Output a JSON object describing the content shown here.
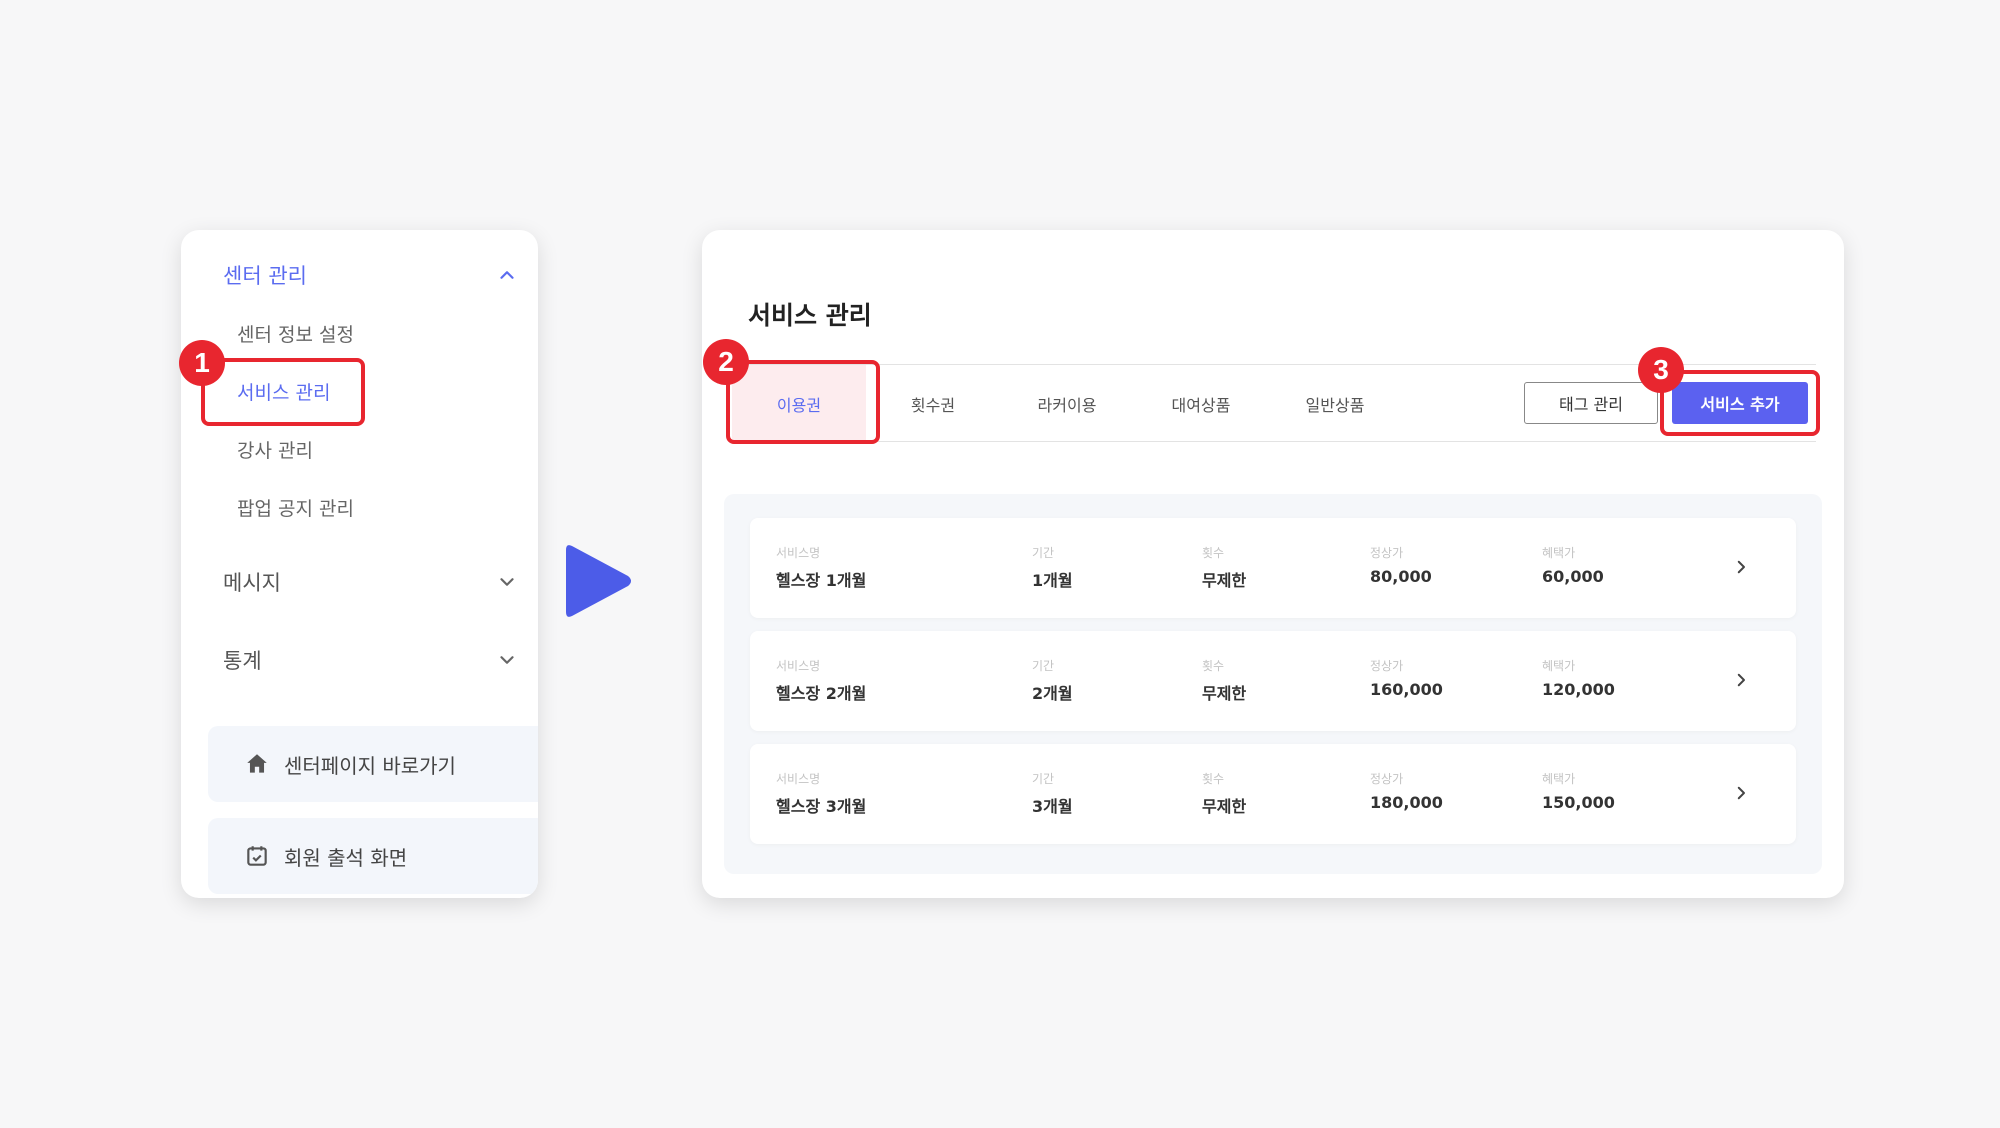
{
  "sidebar": {
    "groups": [
      {
        "label": "센터 관리",
        "expanded": true,
        "items": [
          "센터 정보 설정",
          "서비스 관리",
          "강사 관리",
          "팝업 공지 관리"
        ],
        "active_item": "서비스 관리"
      },
      {
        "label": "메시지",
        "expanded": false
      },
      {
        "label": "통계",
        "expanded": false
      }
    ],
    "shortcuts": [
      {
        "label": "센터페이지 바로가기",
        "icon": "home-icon"
      },
      {
        "label": "회원 출석 화면",
        "icon": "calendar-check-icon"
      }
    ]
  },
  "annotations": {
    "step1": "1",
    "step2": "2",
    "step3": "3"
  },
  "main": {
    "title": "서비스 관리",
    "tabs": [
      "이용권",
      "횟수권",
      "라커이용",
      "대여상품",
      "일반상품"
    ],
    "active_tab": "이용권",
    "buttons": {
      "tag_manage": "태그 관리",
      "add_service": "서비스 추가"
    },
    "columns": [
      "서비스명",
      "기간",
      "횟수",
      "정상가",
      "혜택가"
    ],
    "rows": [
      {
        "name": "헬스장 1개월",
        "period": "1개월",
        "count": "무제한",
        "price": "80,000",
        "sale": "60,000"
      },
      {
        "name": "헬스장 2개월",
        "period": "2개월",
        "count": "무제한",
        "price": "160,000",
        "sale": "120,000"
      },
      {
        "name": "헬스장 3개월",
        "period": "3개월",
        "count": "무제한",
        "price": "180,000",
        "sale": "150,000"
      }
    ]
  },
  "colors": {
    "accent": "#5b6cf0",
    "primary_button": "#5b61f0",
    "highlight": "#e8262f",
    "arrow": "#4c5ce8"
  }
}
